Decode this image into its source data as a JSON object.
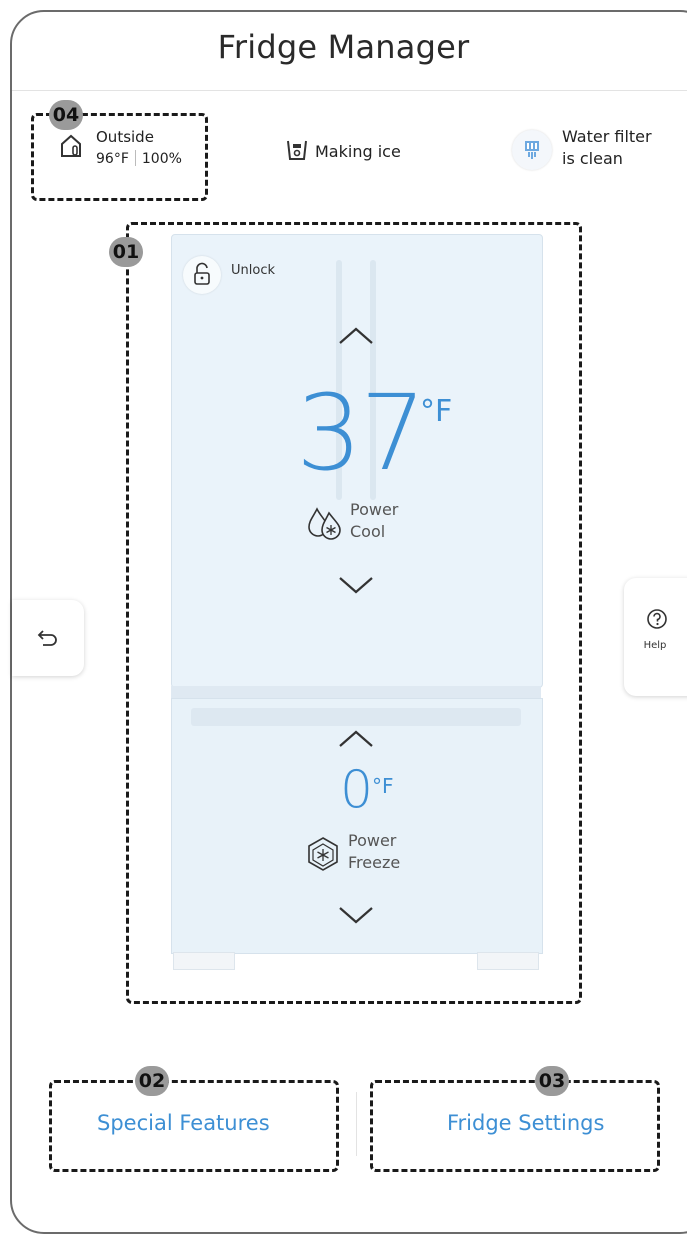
{
  "app": {
    "title": "Fridge Manager"
  },
  "status": {
    "outside_label": "Outside",
    "outside_temp": "96°F",
    "outside_humidity": "100%",
    "ice_label": "Making ice",
    "filter_line1": "Water filter",
    "filter_line2": "is clean"
  },
  "fridge": {
    "unlock_label": "Unlock",
    "fridge_temp": "37",
    "fridge_unit": "°F",
    "fridge_mode_line1": "Power",
    "fridge_mode_line2": "Cool",
    "freezer_temp": "0",
    "freezer_unit": "°F",
    "freezer_mode_line1": "Power",
    "freezer_mode_line2": "Freeze"
  },
  "side": {
    "help_label": "Help"
  },
  "bottom": {
    "special_features": "Special Features",
    "fridge_settings": "Fridge Settings"
  },
  "callouts": {
    "c01": "01",
    "c02": "02",
    "c03": "03",
    "c04": "04"
  },
  "colors": {
    "accent": "#3d8fd4",
    "fridge_panel": "#eaf3fa",
    "callout_badge": "#9a9a9a"
  },
  "icons": [
    "house-icon",
    "ice-maker-icon",
    "water-filter-icon",
    "lock-icon",
    "chevron-up-icon",
    "chevron-down-icon",
    "power-cool-icon",
    "power-freeze-icon",
    "back-icon",
    "help-icon"
  ]
}
